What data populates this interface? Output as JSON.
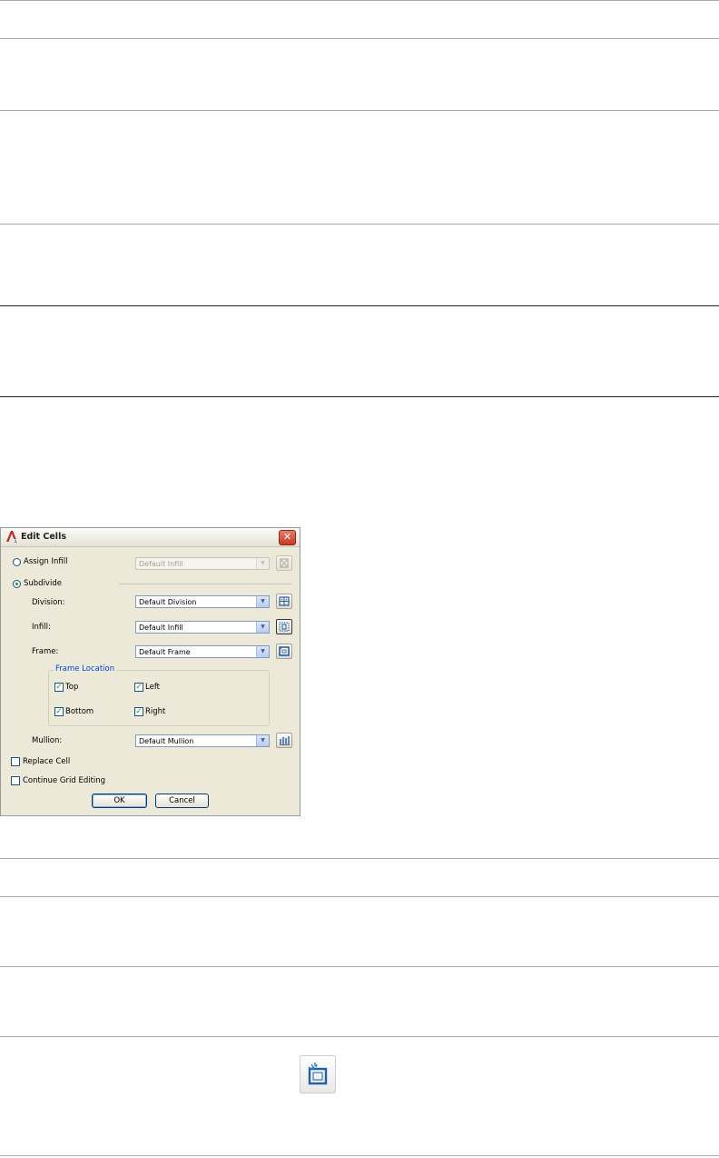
{
  "dialog": {
    "title": "Edit Cells",
    "assign_infill_label": "Assign Infill",
    "assign_infill_value": "Default Infill",
    "subdivide_label": "Subdivide",
    "division_label": "Division:",
    "division_value": "Default Division",
    "infill_label": "Infill:",
    "infill_value": "Default Infill",
    "frame_label": "Frame:",
    "frame_value": "Default Frame",
    "frame_location_title": "Frame Location",
    "top_label": "Top",
    "left_label": "Left",
    "bottom_label": "Bottom",
    "right_label": "Right",
    "mullion_label": "Mullion:",
    "mullion_value": "Default Mullion",
    "replace_cell_label": "Replace Cell",
    "continue_grid_label": "Continue Grid Editing",
    "ok_label": "OK",
    "cancel_label": "Cancel",
    "close_glyph": "✕"
  },
  "state": {
    "assign_infill_selected": false,
    "subdivide_selected": true,
    "top_checked": true,
    "left_checked": true,
    "bottom_checked": true,
    "right_checked": true,
    "replace_cell_checked": false,
    "continue_grid_checked": false
  },
  "colors": {
    "group_title": "#0046d5",
    "check_mark": "#21a121",
    "icon_blue": "#1f5fa8"
  }
}
